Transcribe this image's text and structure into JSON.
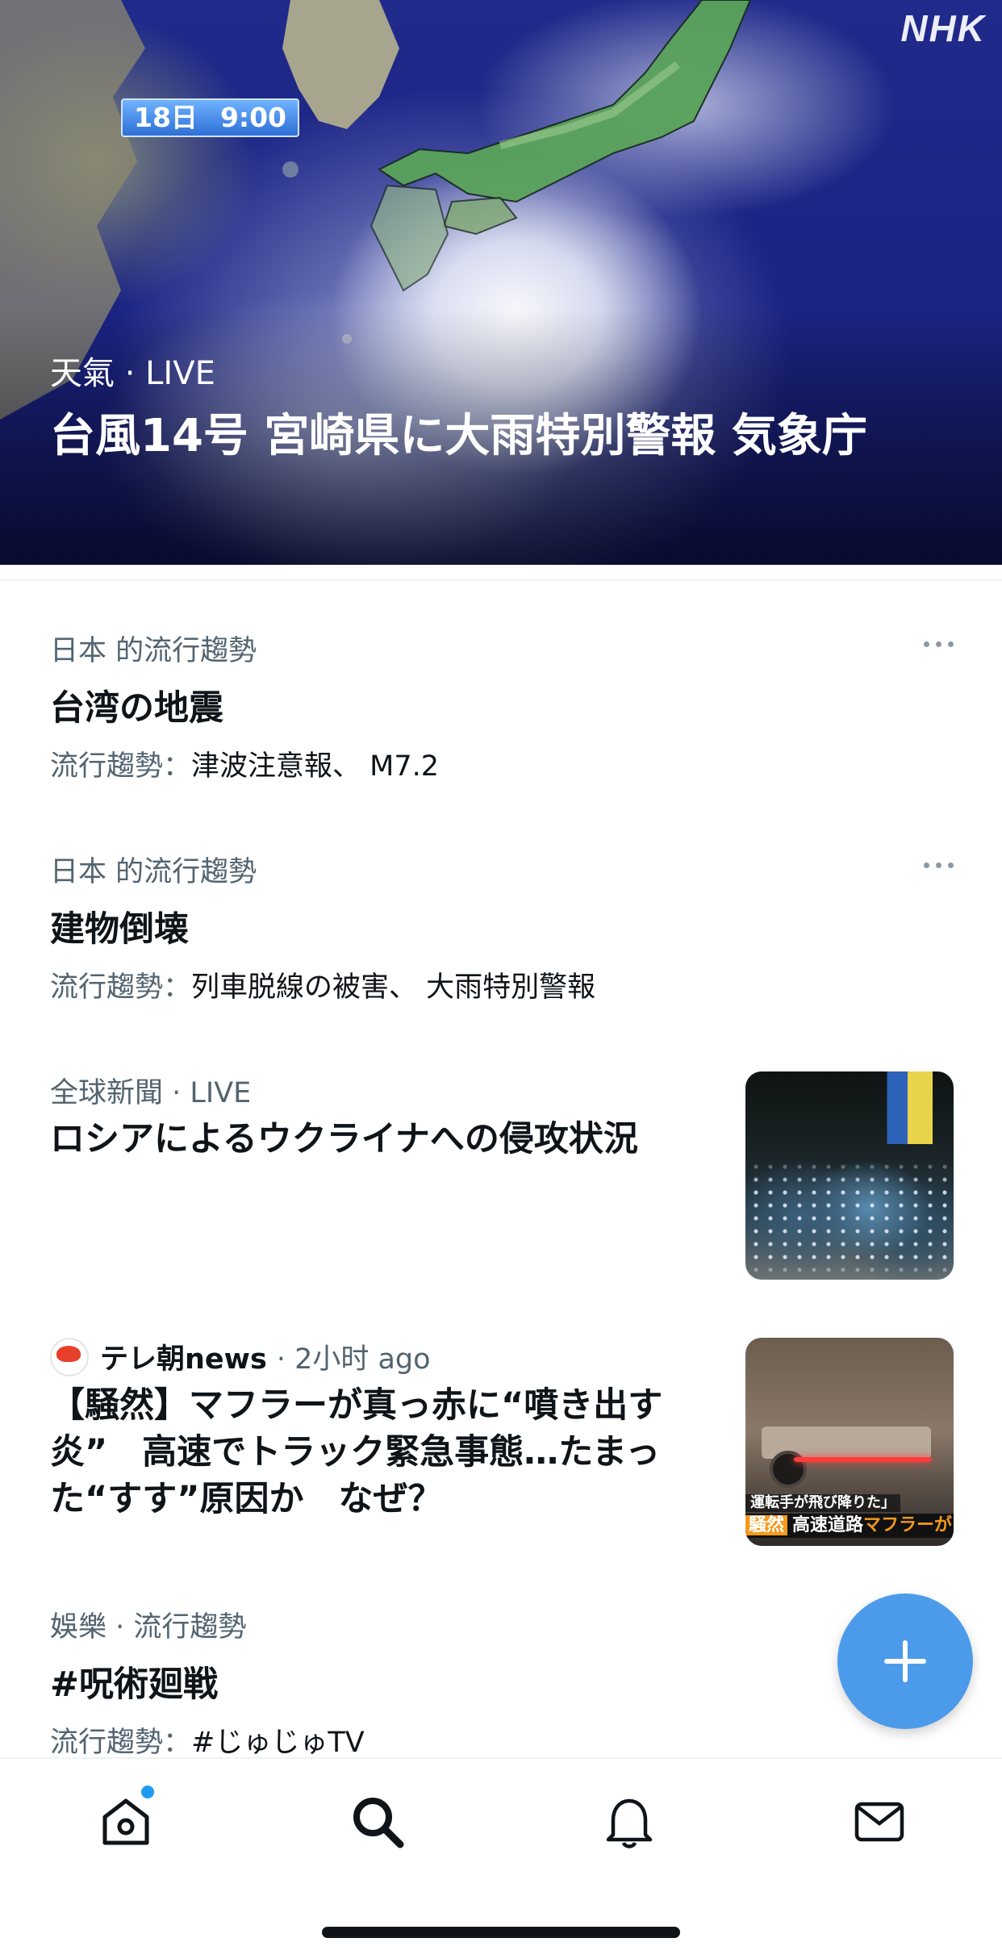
{
  "hero": {
    "watermark": "NHK",
    "timestamp_day": "18日",
    "timestamp_time": "9:00",
    "category": "天氣 · LIVE",
    "title": "台風14号 宮崎県に大雨特別警報 気象庁"
  },
  "trends": [
    {
      "meta": "日本 的流行趨勢",
      "title": "台湾の地震",
      "sub_label": "流行趨勢：",
      "sub_value": "津波注意報、 M7.2"
    },
    {
      "meta": "日本 的流行趨勢",
      "title": "建物倒壊",
      "sub_label": "流行趨勢：",
      "sub_value": "列車脱線の被害、 大雨特別警報"
    }
  ],
  "news": [
    {
      "meta": "全球新聞 · LIVE",
      "title": "ロシアによるウクライナへの侵攻状況"
    },
    {
      "source": "テレ朝news",
      "time": "· 2小时 ago",
      "title": "【騒然】マフラーが真っ赤に“噴き出す炎”　高速でトラック緊急事態…たまった“すす”原因か　なぜ？",
      "thumb_caption_top": "運転手が飛び降りた」",
      "thumb_caption_tag": "騒然",
      "thumb_caption_main": "高速道路",
      "thumb_caption_highlight": "マフラーが"
    }
  ],
  "trend3": {
    "meta": "娛樂 · 流行趨勢",
    "title": "#呪術廻戦",
    "sub_label": "流行趨勢：",
    "sub_value": "#じゅじゅTV"
  },
  "fab": {
    "icon": "plus-icon"
  },
  "nav": {
    "items": [
      "home-icon",
      "search-icon",
      "bell-icon",
      "mail-icon"
    ],
    "active": "search-icon",
    "accent": "#1d9bf0"
  },
  "colors": {
    "fab": "#4c9bea",
    "secondary_text": "#536471",
    "primary_text": "#0f1419"
  }
}
